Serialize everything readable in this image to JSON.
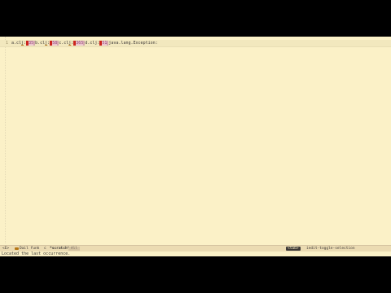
{
  "editor": {
    "line_number": "1",
    "tokens": [
      {
        "type": "text",
        "value": "a.cl",
        "underline": false
      },
      {
        "type": "text",
        "value": "j",
        "underline": true
      },
      {
        "type": "text",
        "value": ":",
        "underline": false
      },
      {
        "type": "num",
        "value": "35"
      },
      {
        "type": "text",
        "value": "b.cl",
        "underline": false
      },
      {
        "type": "text",
        "value": "j",
        "underline": true
      },
      {
        "type": "text",
        "value": ":",
        "underline": false
      },
      {
        "type": "num",
        "value": "58"
      },
      {
        "type": "text",
        "value": "c.cl",
        "underline": false
      },
      {
        "type": "text",
        "value": "j",
        "underline": true
      },
      {
        "type": "text",
        "value": ":",
        "underline": false
      },
      {
        "type": "num",
        "value": "365"
      },
      {
        "type": "text",
        "value": "d.clj:",
        "underline": false
      },
      {
        "type": "num",
        "value": "51"
      },
      {
        "type": "text",
        "value": "java.lang.Exception:",
        "underline": false
      }
    ]
  },
  "modeline": {
    "status": "<E>",
    "path": "Dail funk",
    "lang": "c",
    "file": "*scratch*",
    "pos": "All",
    "key": "<tab>",
    "command": "iedit-toggle-selection"
  },
  "echo": {
    "message": "Located the last occurrence."
  }
}
